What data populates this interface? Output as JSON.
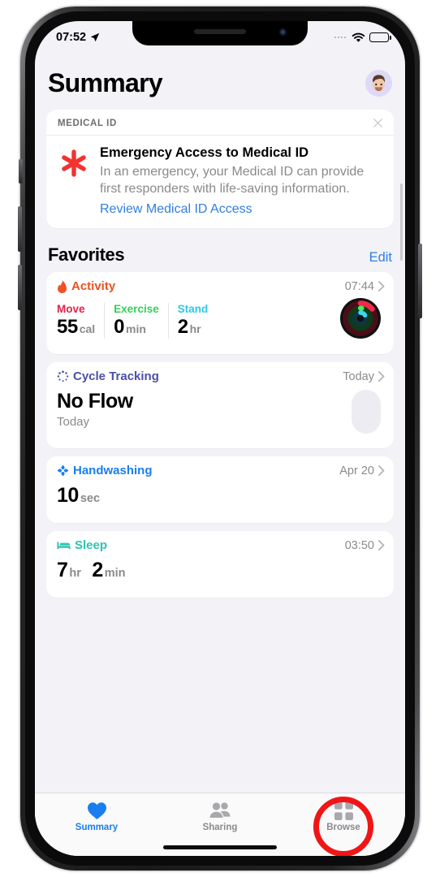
{
  "status_bar": {
    "time": "07:52",
    "location_icon": "location-arrow-icon",
    "wifi_icon": "wifi-icon",
    "battery_icon": "battery-icon"
  },
  "header": {
    "title": "Summary",
    "avatar": "memoji-avatar"
  },
  "medical_card": {
    "section_label": "MEDICAL ID",
    "close_icon": "close-icon",
    "icon": "medical-asterisk-icon",
    "title": "Emergency Access to Medical ID",
    "description": "In an emergency, your Medical ID can provide first responders with life-saving information.",
    "link": "Review Medical ID Access"
  },
  "favorites": {
    "title": "Favorites",
    "edit_label": "Edit",
    "cards": [
      {
        "name": "Activity",
        "icon": "flame-icon",
        "color": "#e9531f",
        "timestamp": "07:44",
        "stats": [
          {
            "label": "Move",
            "color": "#e4214a",
            "value": "55",
            "unit": "cal"
          },
          {
            "label": "Exercise",
            "color": "#33d158",
            "value": "0",
            "unit": "min"
          },
          {
            "label": "Stand",
            "color": "#2ac9e8",
            "value": "2",
            "unit": "hr"
          }
        ],
        "rings_icon": "activity-rings-icon"
      },
      {
        "name": "Cycle Tracking",
        "icon": "cycle-dots-icon",
        "color": "#4b4fa8",
        "timestamp": "Today",
        "value": "No Flow",
        "subvalue": "Today",
        "indicator": "cycle-pill-indicator"
      },
      {
        "name": "Handwashing",
        "icon": "handwashing-droplets-icon",
        "color": "#1a7ef0",
        "timestamp": "Apr 20",
        "value": "10",
        "unit": "sec"
      },
      {
        "name": "Sleep",
        "icon": "bed-icon",
        "color": "#2ec4b0",
        "timestamp": "03:50",
        "value": "7",
        "unit": "hr",
        "value2": "2",
        "unit2": "min"
      }
    ]
  },
  "tab_bar": {
    "tabs": [
      {
        "label": "Summary",
        "icon": "heart-icon",
        "active": true
      },
      {
        "label": "Sharing",
        "icon": "people-icon",
        "active": false
      },
      {
        "label": "Browse",
        "icon": "grid-icon",
        "active": false
      }
    ],
    "highlight": {
      "target": "Browse",
      "color": "#f01616"
    }
  }
}
